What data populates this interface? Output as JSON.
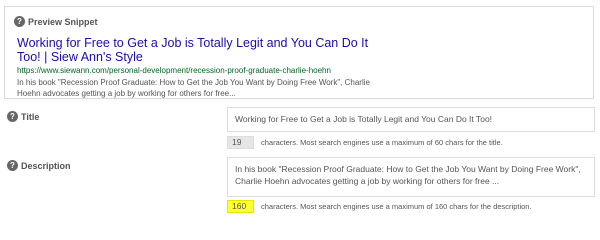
{
  "preview": {
    "heading": "Preview Snippet",
    "title": "Working for Free to Get a Job is Totally Legit and You Can Do It Too! | Siew Ann's Style",
    "url": "https://www.siewann.com/personal-development/recession-proof-graduate-charlie-hoehn",
    "description": "In his book \"Recession Proof Graduate: How to Get the Job You Want by Doing Free Work\", Charlie Hoehn advocates getting a job by working for others for free..."
  },
  "title_field": {
    "label": "Title",
    "value": "Working for Free to Get a Job is Totally Legit and You Can Do It Too!",
    "count": "19",
    "note": "characters. Most search engines use a maximum of 60 chars for the title."
  },
  "description_field": {
    "label": "Description",
    "value": "In his book \"Recession Proof Graduate: How to Get the Job You Want by Doing Free Work\", Charlie Hoehn advocates getting a job by working for others for free ...",
    "count": "160",
    "note": "characters. Most search engines use a maximum of 160 chars for the description.",
    "count_highlight": "#ffff33"
  },
  "icons": {
    "help": "?"
  }
}
